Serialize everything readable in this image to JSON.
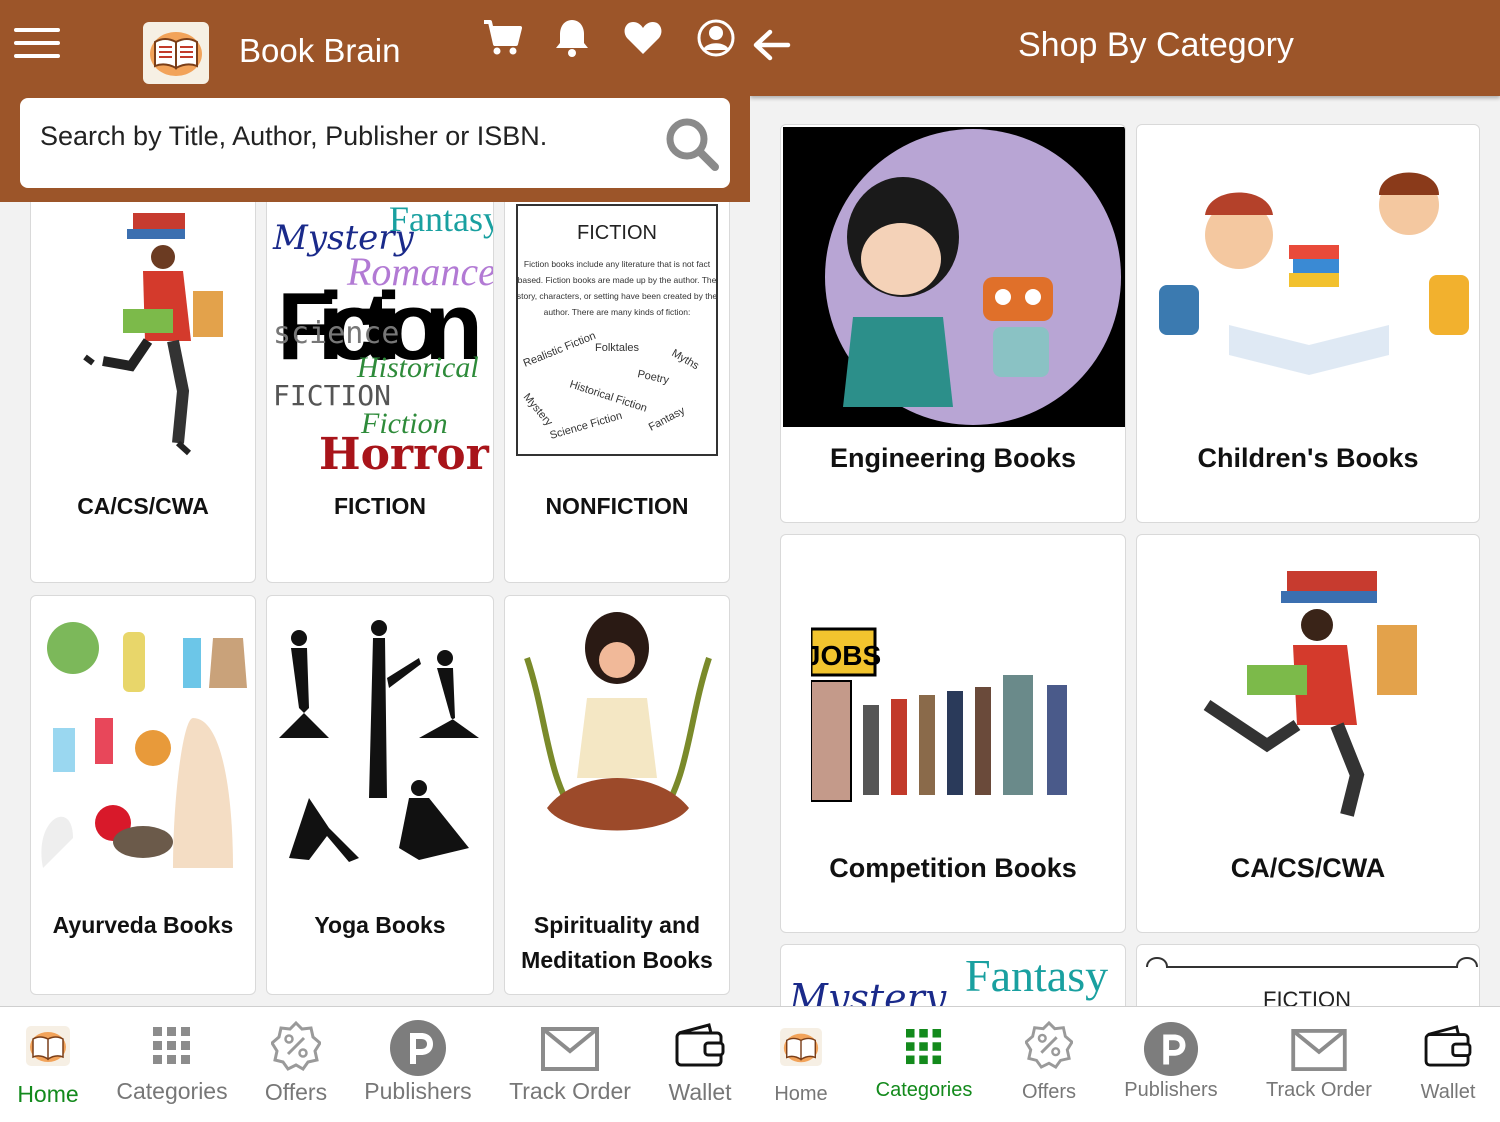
{
  "app": {
    "title": "Book Brain"
  },
  "search": {
    "placeholder": "Search by Title, Author, Publisher or ISBN."
  },
  "left_categories": [
    {
      "label": "CA/CS/CWA"
    },
    {
      "label": "FICTION"
    },
    {
      "label": "NONFICTION"
    },
    {
      "label": "Ayurveda Books"
    },
    {
      "label": "Yoga Books"
    },
    {
      "label_line1": "Spirituality and",
      "label_line2": "Meditation Books"
    }
  ],
  "fiction_art": {
    "w1": "Mystery",
    "w2": "Fantasy",
    "w3": "Fiction",
    "w4": "Romance",
    "w5": "science",
    "w6": "Historical",
    "w7": "FICTION",
    "w8": "Fiction",
    "w9": "Horror"
  },
  "nonfiction_art": {
    "title": "FICTION",
    "body1": "Fiction books include any literature that is not fact",
    "body2": "based. Fiction books are made up by the author. The",
    "body3": "story, characters, or setting have been created by the",
    "body4": "author. There are many kinds of fiction:",
    "k1": "Realistic Fiction",
    "k2": "Folktales",
    "k3": "Myths",
    "k4": "Poetry",
    "k5": "Historical Fiction",
    "k6": "Mystery",
    "k7": "Science Fiction",
    "k8": "Fantasy"
  },
  "jobs_sign": "JOBS",
  "right_header": {
    "title": "Shop By Category"
  },
  "right_categories": [
    {
      "label": "Engineering Books"
    },
    {
      "label": "Children's Books"
    },
    {
      "label": "Competition Books"
    },
    {
      "label": "CA/CS/CWA"
    }
  ],
  "right_partial": {
    "w1": "Mystery",
    "w2": "Fantasy",
    "w3": "FICTION"
  },
  "bottom_nav_left": [
    {
      "label": "Home",
      "icon": "book-logo-icon",
      "active": true
    },
    {
      "label": "Categories",
      "icon": "grid-icon"
    },
    {
      "label": "Offers",
      "icon": "percent-badge-icon"
    },
    {
      "label": "Publishers",
      "icon": "p-circle-icon"
    },
    {
      "label": "Track Order",
      "icon": "envelope-icon"
    },
    {
      "label": "Wallet",
      "icon": "wallet-icon"
    }
  ],
  "bottom_nav_right": [
    {
      "label": "Home",
      "icon": "book-logo-icon"
    },
    {
      "label": "Categories",
      "icon": "grid-icon",
      "active": true
    },
    {
      "label": "Offers",
      "icon": "percent-badge-icon"
    },
    {
      "label": "Publishers",
      "icon": "p-circle-icon"
    },
    {
      "label": "Track Order",
      "icon": "envelope-icon"
    },
    {
      "label": "Wallet",
      "icon": "wallet-icon"
    }
  ],
  "colors": {
    "header": "#9c5529",
    "active_nav": "#138a1c",
    "inactive_nav": "#777777",
    "background": "#f2f2f2"
  }
}
